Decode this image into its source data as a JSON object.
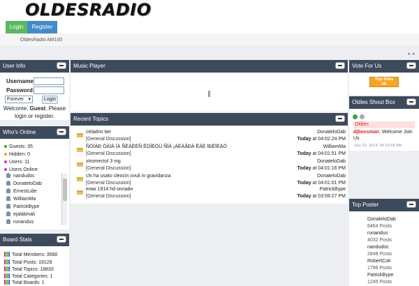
{
  "header": {
    "logo": "OLDESRADIO",
    "site_name": "OldesRadio AM100"
  },
  "nav": {
    "login": "Login",
    "register": "Register"
  },
  "panels": {
    "user_info": "User Info",
    "music_player": "Music Player",
    "vote": "Vote For Us",
    "recent_topics": "Recent Topics",
    "shoutbox": "Oldies Shout Box",
    "whos_online": "Who's Online",
    "board_stats": "Board Stats",
    "top_poster": "Top Poster"
  },
  "login_form": {
    "username_label": "Username:",
    "password_label": "Password:",
    "remember_option": "Forever",
    "login_button": "Login",
    "welcome_prefix": "Welcome, ",
    "welcome_user": "Guest",
    "welcome_suffix": ". Please",
    "welcome_line2": "login or register."
  },
  "online": {
    "guests": "Guests: 35",
    "hidden": "Hidden: 0",
    "users": "Users: 11",
    "users_online": "Users Online:",
    "user_list": [
      "nandudoc",
      "DonateloDab",
      "ErnestLide",
      "WilliamMa",
      "PatrickBype",
      "ejalabinali",
      "runandus"
    ]
  },
  "board_stats": {
    "members": "Total Members: 3580",
    "posts": "Total Posts: 19128",
    "topics": "Total Topics: 18833",
    "categories": "Total Categories: 1",
    "boards": "Total Boards: 1"
  },
  "topics": [
    {
      "title": "celadrin tier",
      "category": "[General Discussion]",
      "user": "DonateloDab",
      "day": "Today",
      "time": " at 04:02:24 PM"
    },
    {
      "title": "ÑÓÏÀÐ ÖÀÏÀ ÌÀ ÑÈÀÈÉÑ ÊÖÍÈÖÙ ÑÏÀ ¡ÀÉÀÂÐÀ ÊÀÈ ÏÐÈÏÈÄÓ",
      "category": "[General Discussion]",
      "user": "WilliamMa",
      "day": "Today",
      "time": " at 04:01:51 PM"
    },
    {
      "title": "stromectol 3 mg",
      "category": "[General Discussion]",
      "user": "DonateloDab",
      "day": "Today",
      "time": " at 04:01:16 PM"
    },
    {
      "title": "chi ha usato cleocin ovuli in gravidanza",
      "category": "[General Discussion]",
      "user": "DonateloDab",
      "day": "Today",
      "time": " at 04:01:01 PM"
    },
    {
      "title": "елки 1914 hd онлайн",
      "category": "[General Discussion]",
      "user": "PatrickBype",
      "day": "Today",
      "time": " at 03:59:27 PM"
    }
  ],
  "vote": {
    "badge_line1": "Top Sites",
    "badge_line2": "#5"
  },
  "shoutbox": {
    "room": "Oldies",
    "author": "djbossman",
    "message": ": Welcome Join Us",
    "date": "July 31, 2014, 06:23:09 AM"
  },
  "top_posters": [
    {
      "name": "DonateloDab",
      "posts": "6464 Posts"
    },
    {
      "name": "runandus",
      "posts": "4032 Posts"
    },
    {
      "name": "nandudoc",
      "posts": "2848 Posts"
    },
    {
      "name": "RobertCok",
      "posts": "1796 Posts"
    },
    {
      "name": "PatrickBype",
      "posts": "1245 Posts"
    }
  ],
  "colors": {
    "panel_header": "#3d4a5b",
    "login_green": "#5cb85c",
    "register_blue": "#428bca",
    "shout_red": "#d22"
  }
}
